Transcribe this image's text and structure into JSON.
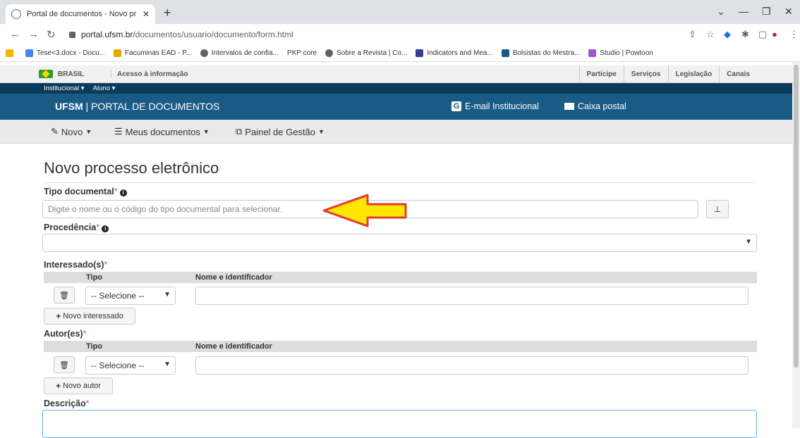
{
  "browser": {
    "tab_title": "Portal de documentos - Novo pr",
    "url_host": "portal.ufsm.br",
    "url_path": "/documentos/usuario/documento/form.html",
    "bookmarks": [
      {
        "label": "Tese<3.docx - Docu...",
        "color": "#4285f4"
      },
      {
        "label": "Facuminas EAD - P...",
        "color": "#e6a700"
      },
      {
        "label": "Intervalos de confia...",
        "color": "#5f6368"
      },
      {
        "label": "PKP core",
        "color": "#333333"
      },
      {
        "label": "Sobre a Revista | Co...",
        "color": "#5f6368"
      },
      {
        "label": "Indicators and Mea...",
        "color": "#3b3b8f"
      },
      {
        "label": "Bolsistas do Mestra...",
        "color": "#1a5b86"
      },
      {
        "label": "Studio | Powtoon",
        "color": "#9b59d0"
      }
    ]
  },
  "govbar": {
    "brasil": "BRASIL",
    "acesso": "Acesso à informação",
    "links": [
      "Participe",
      "Serviços",
      "Legislação",
      "Canais"
    ]
  },
  "header": {
    "inst_menu": [
      "Institucional ▾",
      "Aluno ▾"
    ],
    "brand_strong": "UFSM",
    "brand_rest": " | PORTAL DE DOCUMENTOS",
    "email": "E-mail Institucional",
    "caixa": "Caixa postal"
  },
  "menu": {
    "novo": "Novo",
    "meus": "Meus documentos",
    "painel": "Painel de Gestão"
  },
  "form": {
    "title": "Novo processo eletrônico",
    "tipo_label": "Tipo documental",
    "tipo_placeholder": "Digite o nome ou o código do tipo documental para selecionar.",
    "procedencia_label": "Procedência",
    "interessados_label": "Interessado(s)",
    "col_tipo": "Tipo",
    "col_nome": "Nome e identificador",
    "select_default": "-- Selecione --",
    "novo_interessado": "Novo interessado",
    "autores_label": "Autor(es)",
    "novo_autor": "Novo autor",
    "descricao_label": "Descrição",
    "required_mark": "*"
  },
  "annotation": {
    "arrow_fill": "#ffe600",
    "arrow_stroke": "#e53935"
  }
}
